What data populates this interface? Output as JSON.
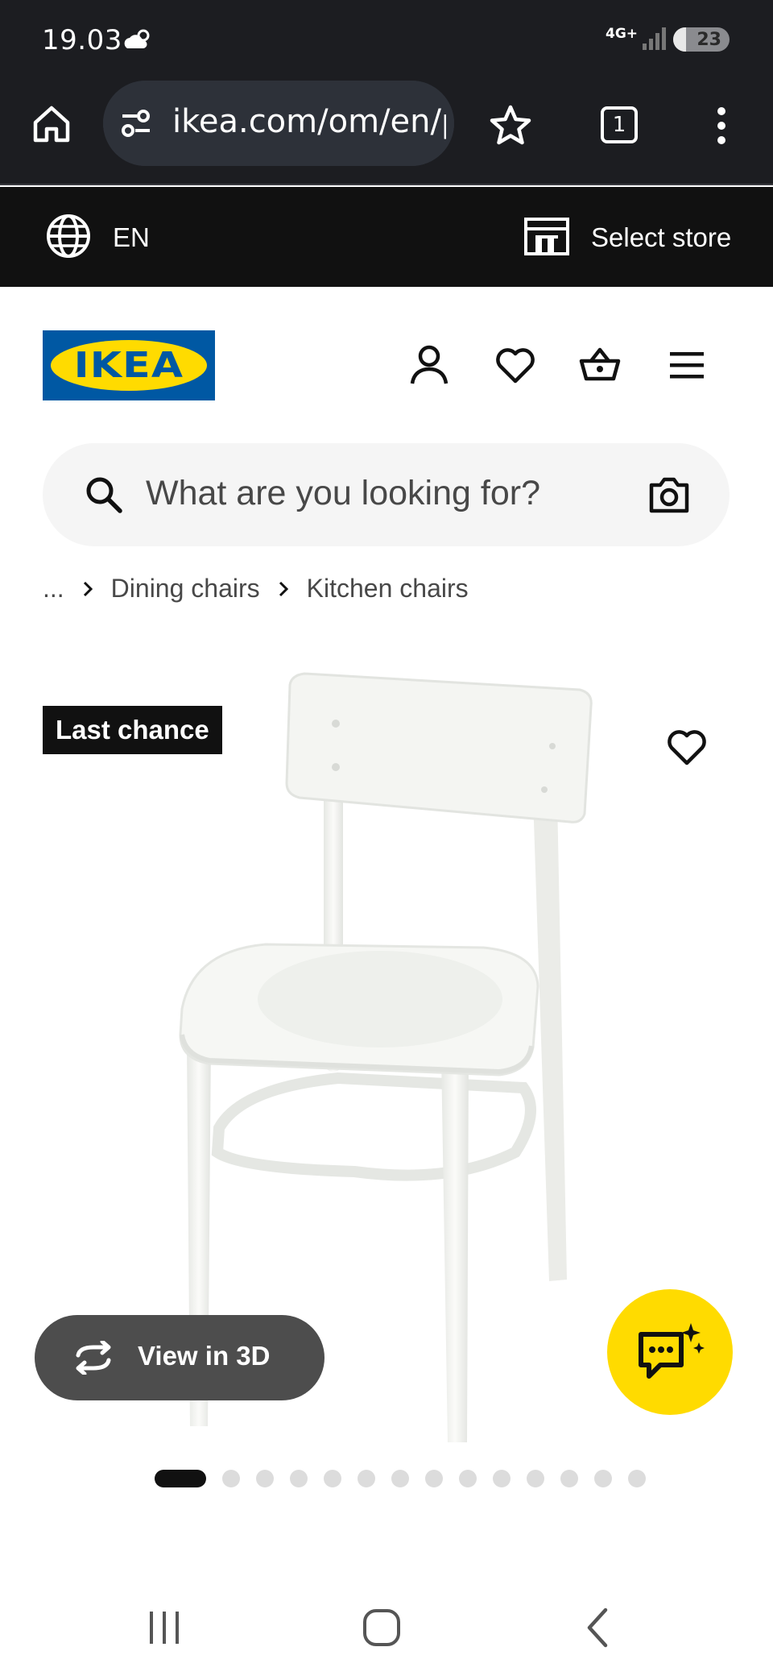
{
  "status_bar": {
    "time": "19.03",
    "network": "4G+",
    "battery_level": "23",
    "battery_fraction": 0.23,
    "icons": [
      "weather-cloudy-icon",
      "signal-icon",
      "battery-icon"
    ]
  },
  "browser": {
    "url": "ikea.com/om/en/p",
    "tab_count": "1",
    "icons": [
      "home-icon",
      "site-settings-icon",
      "bookmark-star-icon",
      "tab-switcher-icon",
      "overflow-menu-icon"
    ]
  },
  "locale_bar": {
    "language": "EN",
    "store_label": "Select store"
  },
  "header": {
    "logo_text": "IKEA",
    "icons": [
      "profile-icon",
      "favourites-heart-icon",
      "shopping-basket-icon",
      "hamburger-menu-icon"
    ]
  },
  "search": {
    "placeholder": "What are you looking for?"
  },
  "breadcrumb": {
    "items": [
      "...",
      "Dining chairs",
      "Kitchen chairs"
    ]
  },
  "product": {
    "badge": "Last chance",
    "view_3d_label": "View in 3D",
    "image_count": 14,
    "active_image_index": 0
  },
  "colors": {
    "ikea_blue": "#0058a3",
    "ikea_yellow": "#ffdb00",
    "browser_dark": "#1c1d21",
    "locale_bar": "#111111"
  }
}
